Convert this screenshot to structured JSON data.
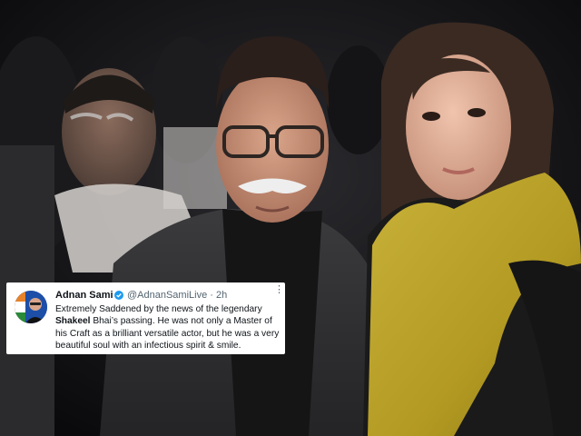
{
  "photo": {
    "description_icon": "photo-of-three-people"
  },
  "tweet": {
    "display_name": "Adnan Sami",
    "verified_icon": "verified-badge-icon",
    "handle_time": "@AdnanSamiLive · 2h",
    "more_icon": "more-dots-icon",
    "text_before": "Extremely Saddened by the news of the legendary ",
    "text_bold": "Shakeel",
    "text_after": " Bhai’s passing. He was not only a Master of his Craft as a brilliant versatile actor, but he was a very beautiful soul with an infectious spirit & smile.",
    "colors": {
      "card_bg": "#ffffff",
      "text": "#0f1419",
      "muted": "#536471",
      "verified": "#1d9bf0"
    }
  }
}
